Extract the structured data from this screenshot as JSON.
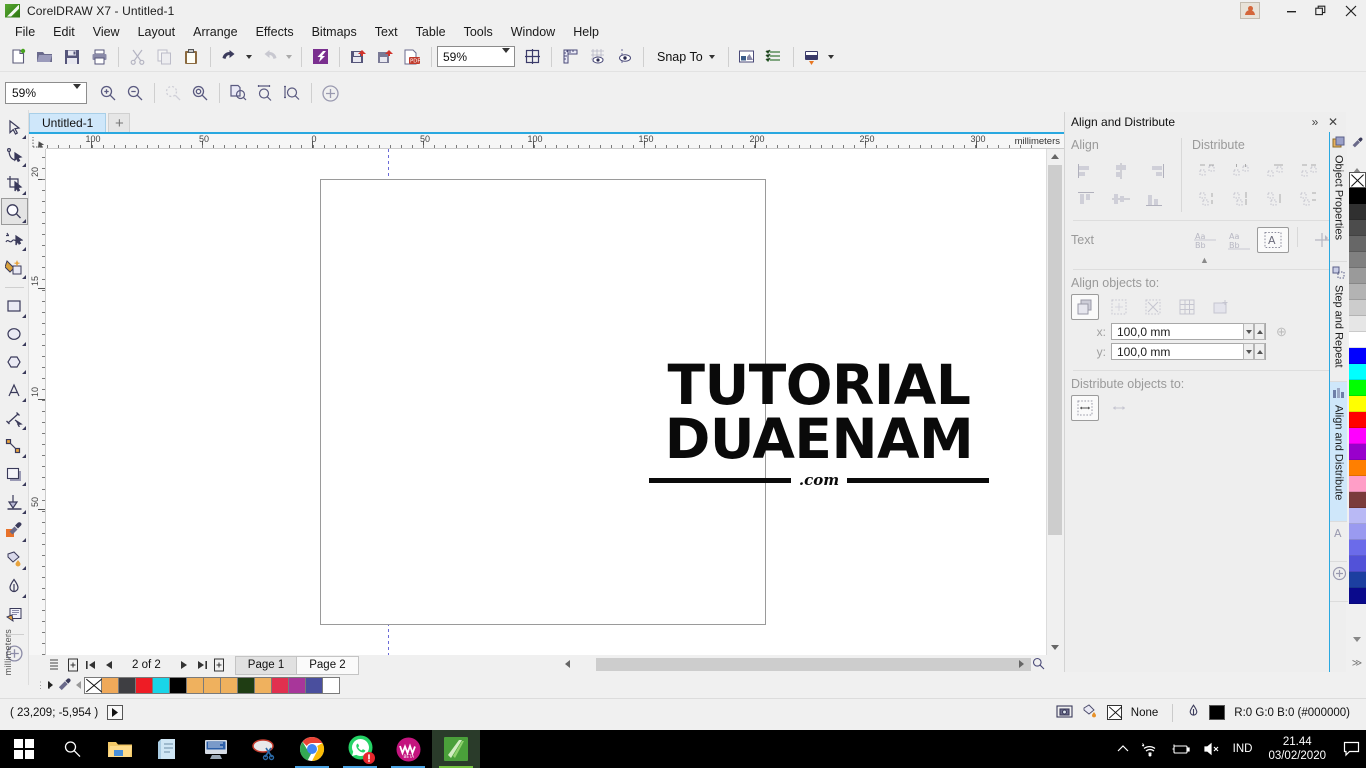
{
  "window": {
    "app_title": "CorelDRAW X7 - Untitled-1",
    "app_icon": "coreldraw-logo-icon",
    "minimize": "—",
    "restore": "❐",
    "close": "✕"
  },
  "menubar": {
    "items": [
      {
        "label": "File",
        "mnemonic": "F"
      },
      {
        "label": "Edit",
        "mnemonic": "E"
      },
      {
        "label": "View",
        "mnemonic": "V"
      },
      {
        "label": "Layout",
        "mnemonic": "L"
      },
      {
        "label": "Arrange",
        "mnemonic": "A"
      },
      {
        "label": "Effects",
        "mnemonic": "c"
      },
      {
        "label": "Bitmaps",
        "mnemonic": "B"
      },
      {
        "label": "Text",
        "mnemonic": "x"
      },
      {
        "label": "Table",
        "mnemonic": "T"
      },
      {
        "label": "Tools",
        "mnemonic": "o"
      },
      {
        "label": "Window",
        "mnemonic": "W"
      },
      {
        "label": "Help",
        "mnemonic": "H"
      }
    ]
  },
  "toolbar": {
    "new_label": "New",
    "open_label": "Open",
    "save_label": "Save",
    "print_label": "Print",
    "cut_label": "Cut",
    "copy_label": "Copy",
    "paste_label": "Paste",
    "undo_label": "Undo",
    "redo_label": "Redo",
    "corel_connect_label": "Corel CONNECT",
    "import_label": "Import",
    "export_label": "Export",
    "publish_pdf_label": "Publish to PDF",
    "zoom_level": "59%",
    "fullscreen_label": "Full-Screen Preview",
    "options_label": "Options",
    "snap_to_label": "Snap To",
    "ruler_label": "Show Rulers",
    "grid_label": "Show Grid",
    "guides_label": "Show Guidelines",
    "launch_label": "Application Launcher"
  },
  "propbar": {
    "zoom_level": "59%",
    "zoom_in_label": "Zoom In",
    "zoom_out_label": "Zoom Out",
    "zoom_selected_label": "Zoom to Selected",
    "zoom_all_label": "Zoom to All Objects",
    "zoom_page_label": "Zoom to Page",
    "zoom_width_label": "Zoom to Page Width",
    "zoom_height_label": "Zoom to Page Height"
  },
  "toolbox": {
    "tools": [
      {
        "name": "pick-tool",
        "label": "Pick",
        "flyout": true,
        "active": false
      },
      {
        "name": "shape-tool",
        "label": "Shape",
        "flyout": true,
        "active": false
      },
      {
        "name": "crop-tool",
        "label": "Crop",
        "flyout": true,
        "active": false
      },
      {
        "name": "zoom-tool",
        "label": "Zoom",
        "flyout": true,
        "active": true
      },
      {
        "name": "freehand-tool",
        "label": "Freehand",
        "flyout": true,
        "active": false
      },
      {
        "name": "smart-fill-tool",
        "label": "Smart Fill",
        "flyout": true,
        "active": false
      },
      {
        "name": "rectangle-tool",
        "label": "Rectangle",
        "flyout": true,
        "active": false
      },
      {
        "name": "ellipse-tool",
        "label": "Ellipse",
        "flyout": true,
        "active": false
      },
      {
        "name": "polygon-tool",
        "label": "Polygon",
        "flyout": true,
        "active": false
      },
      {
        "name": "text-tool",
        "label": "Text",
        "flyout": true,
        "active": false
      },
      {
        "name": "parallel-dimension-tool",
        "label": "Parallel Dimension",
        "flyout": true,
        "active": false
      },
      {
        "name": "straight-line-connector-tool",
        "label": "Straight-Line Connector",
        "flyout": true,
        "active": false
      },
      {
        "name": "drop-shadow-tool",
        "label": "Drop Shadow",
        "flyout": true,
        "active": false
      },
      {
        "name": "transparency-tool",
        "label": "Transparency",
        "flyout": false,
        "active": false
      },
      {
        "name": "color-eyedropper-tool",
        "label": "Color Eyedropper",
        "flyout": true,
        "active": false
      },
      {
        "name": "fill-tool",
        "label": "Fill",
        "flyout": true,
        "active": false
      },
      {
        "name": "outline-tool",
        "label": "Outline",
        "flyout": true,
        "active": false
      },
      {
        "name": "interactive-fill-tool",
        "label": "Interactive Fill",
        "flyout": false,
        "active": false
      },
      {
        "name": "quick-customize-tool",
        "label": "Quick Customize",
        "flyout": false,
        "active": false
      }
    ],
    "units_label": "millimeters"
  },
  "document": {
    "tab_label": "Untitled-1",
    "add_tab_label": "+"
  },
  "rulers": {
    "units": "millimeters",
    "h_labels": [
      "100",
      "50",
      "0",
      "50",
      "100",
      "150",
      "200",
      "250",
      "300"
    ],
    "v_labels": [
      "20",
      "15",
      "10",
      "50"
    ]
  },
  "canvas": {
    "logo_line1": "TUTORIAL",
    "logo_line2": "DUAENAM",
    "logo_dotcom": ".com"
  },
  "pagenav": {
    "add_page_before_label": "Insert Page Before",
    "first_label": "First Page",
    "prev_label": "Previous Page",
    "counter": "2 of 2",
    "next_label": "Next Page",
    "last_label": "Last Page",
    "add_page_after_label": "Insert Page After",
    "pages": [
      {
        "label": "Page 1",
        "active": false
      },
      {
        "label": "Page 2",
        "active": true
      }
    ]
  },
  "palette_bottom": {
    "eyedropper_label": "Color Eyedropper",
    "swatches": [
      "none",
      "#efa95a",
      "#3e3e42",
      "#ee1c25",
      "#1ad5e8",
      "#000000",
      "#efb15e",
      "#efb15e",
      "#efb15e",
      "#1f3d13",
      "#efb15e",
      "#e1304f",
      "#a8369a",
      "#4a4f9e",
      "#ffffff"
    ]
  },
  "palette_right": {
    "swatches": [
      "none",
      "#000000",
      "#303030",
      "#4c4c4c",
      "#676767",
      "#808080",
      "#9a9a9a",
      "#b3b3b3",
      "#cccccc",
      "#e6e6e6",
      "#ffffff",
      "#0000ff",
      "#00ffff",
      "#00ff00",
      "#ffff00",
      "#ff0000",
      "#ff00ff",
      "#9900cc",
      "#ff7f00",
      "#ff9ec7",
      "#7a3b3b",
      "#b9b9f5",
      "#9a9af0",
      "#6b6bea",
      "#5252d8",
      "#1c3fa0",
      "#0a0a8c"
    ]
  },
  "statusbar": {
    "coordinates": "( 23,209; -5,954 )",
    "play_label": "Play",
    "fill_label": "None",
    "outline_color_label": "R:0 G:0 B:0 (#000000)",
    "outline_color_hex": "#000000"
  },
  "docker": {
    "title": "Align and Distribute",
    "collapse_label": "»",
    "close_label": "✕",
    "align_title": "Align",
    "distribute_title": "Distribute",
    "text_title": "Text",
    "align_objects_to_title": "Align objects to:",
    "distribute_objects_to_title": "Distribute objects to:",
    "align_buttons": [
      "align-left",
      "align-center-horizontally",
      "align-right",
      "align-top",
      "align-center-vertically",
      "align-bottom"
    ],
    "distribute_buttons": [
      "distribute-left",
      "distribute-center-horizontally",
      "distribute-spacing-horizontally",
      "distribute-right",
      "distribute-top",
      "distribute-center-vertically",
      "distribute-spacing-vertically",
      "distribute-bottom"
    ],
    "text_buttons": [
      "text-first-line-baseline",
      "text-last-line-baseline",
      "text-bounding-box",
      "text-outline"
    ],
    "align_to_buttons": [
      {
        "name": "active-objects",
        "selected": true
      },
      {
        "name": "edge-of-page",
        "selected": false
      },
      {
        "name": "center-of-page",
        "selected": false
      },
      {
        "name": "grid",
        "selected": false
      },
      {
        "name": "specified-point",
        "selected": false
      }
    ],
    "x_label": "x:",
    "x_value": "100,0 mm",
    "y_label": "y:",
    "y_value": "100,0 mm",
    "distribute_to_buttons": [
      {
        "name": "extent-of-selection",
        "selected": true
      },
      {
        "name": "extent-of-page",
        "selected": false
      }
    ]
  },
  "dock_tabs": [
    {
      "label": "Object Properties",
      "icon": "object-properties-icon",
      "active": false
    },
    {
      "label": "Step and Repeat",
      "icon": "step-and-repeat-icon",
      "active": false
    },
    {
      "label": "Align and Distribute",
      "icon": "align-distribute-icon",
      "active": true
    },
    {
      "label": "",
      "icon": "text-properties-icon",
      "active": false
    },
    {
      "label": "",
      "icon": "quick-customize-icon",
      "active": false
    }
  ],
  "taskbar": {
    "start_label": "Start",
    "search_label": "Search",
    "items": [
      {
        "name": "file-explorer",
        "running": false,
        "active": false
      },
      {
        "name": "notepad",
        "running": false,
        "active": false
      },
      {
        "name": "powerpoint-like",
        "running": false,
        "active": false
      },
      {
        "name": "snipping-tool",
        "running": false,
        "active": false
      },
      {
        "name": "google-chrome",
        "running": true,
        "active": false
      },
      {
        "name": "whatsapp",
        "running": true,
        "active": false
      },
      {
        "name": "wattpad",
        "running": true,
        "active": false
      },
      {
        "name": "coreldraw",
        "running": true,
        "active": true
      }
    ],
    "tray": {
      "chevron": "∧",
      "network_label": "network-icon",
      "battery_label": "battery-icon",
      "volume_label": "volume-muted-icon",
      "language": "IND",
      "time": "21.44",
      "date": "03/02/2020",
      "notifications_label": "action-center-icon"
    }
  }
}
